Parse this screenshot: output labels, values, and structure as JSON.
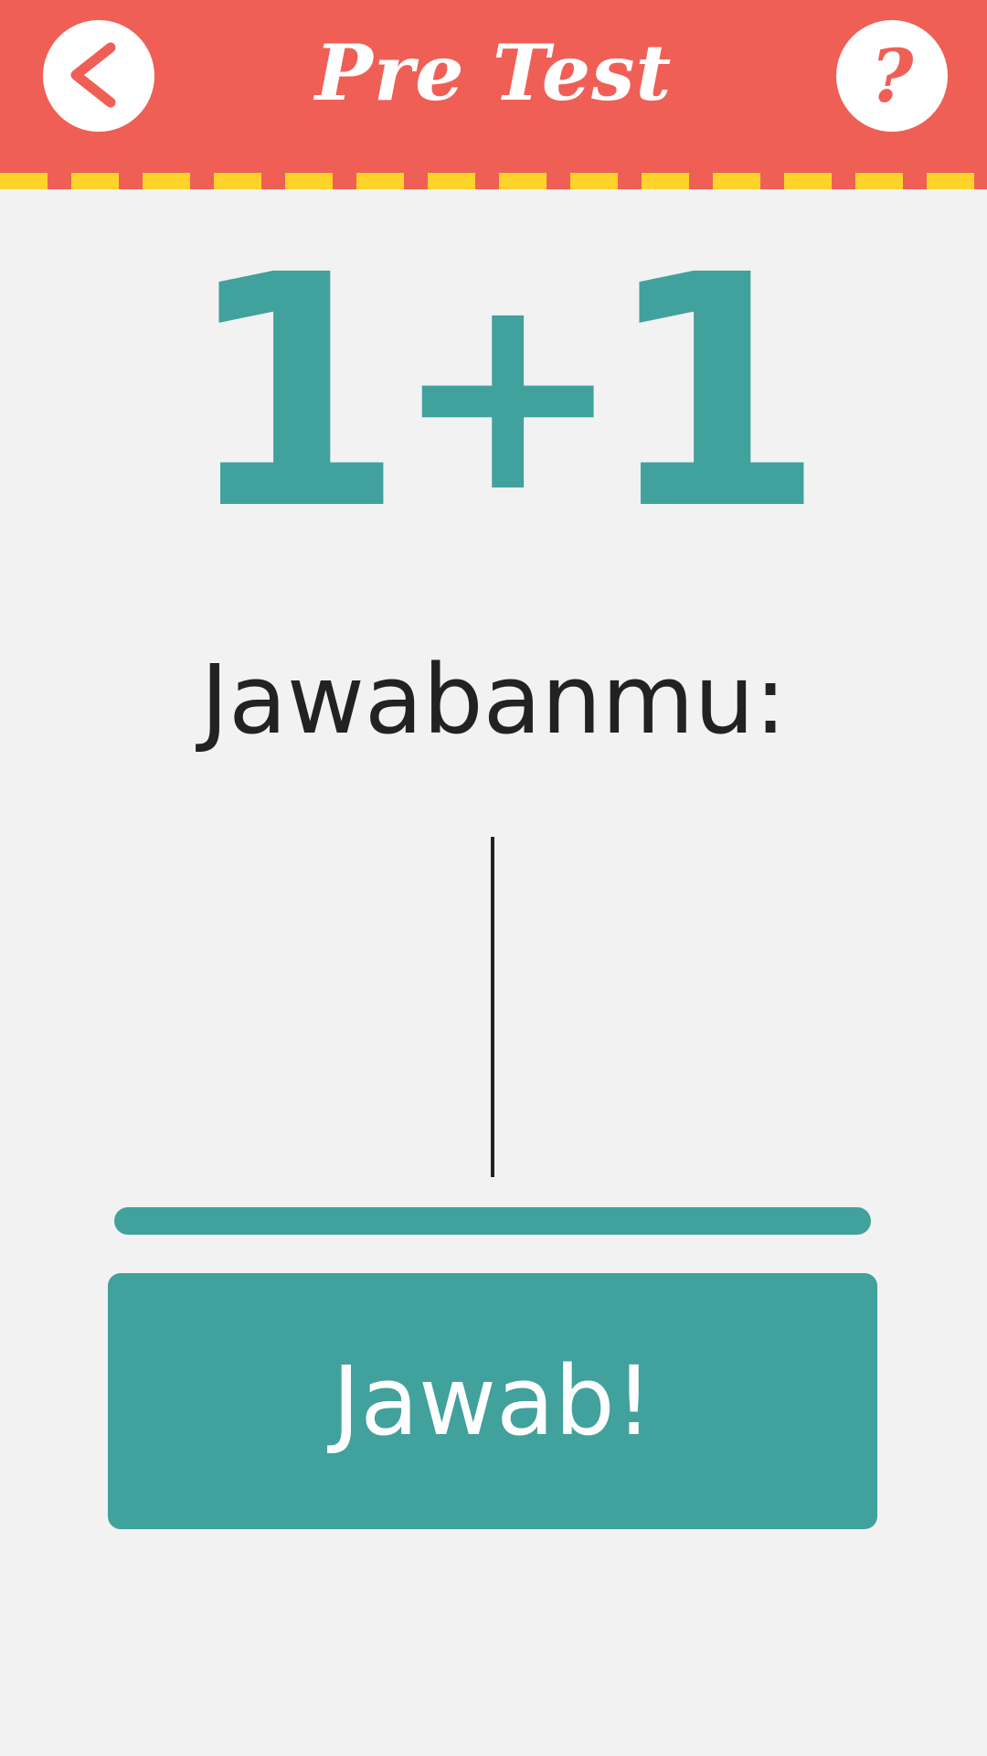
{
  "header": {
    "title": "Pre Test",
    "back_icon": "chevron-left-icon",
    "help_icon": "question-mark-icon",
    "help_glyph": "?"
  },
  "question": {
    "left": "1",
    "operator": "+",
    "right": "1"
  },
  "answer": {
    "label": "Jawabanmu:",
    "value": ""
  },
  "submit": {
    "label": "Jawab!"
  },
  "colors": {
    "header": "#f05f55",
    "stripe": "#ffd42a",
    "accent": "#41a19d",
    "background": "#f2f2f2",
    "text": "#222222"
  }
}
